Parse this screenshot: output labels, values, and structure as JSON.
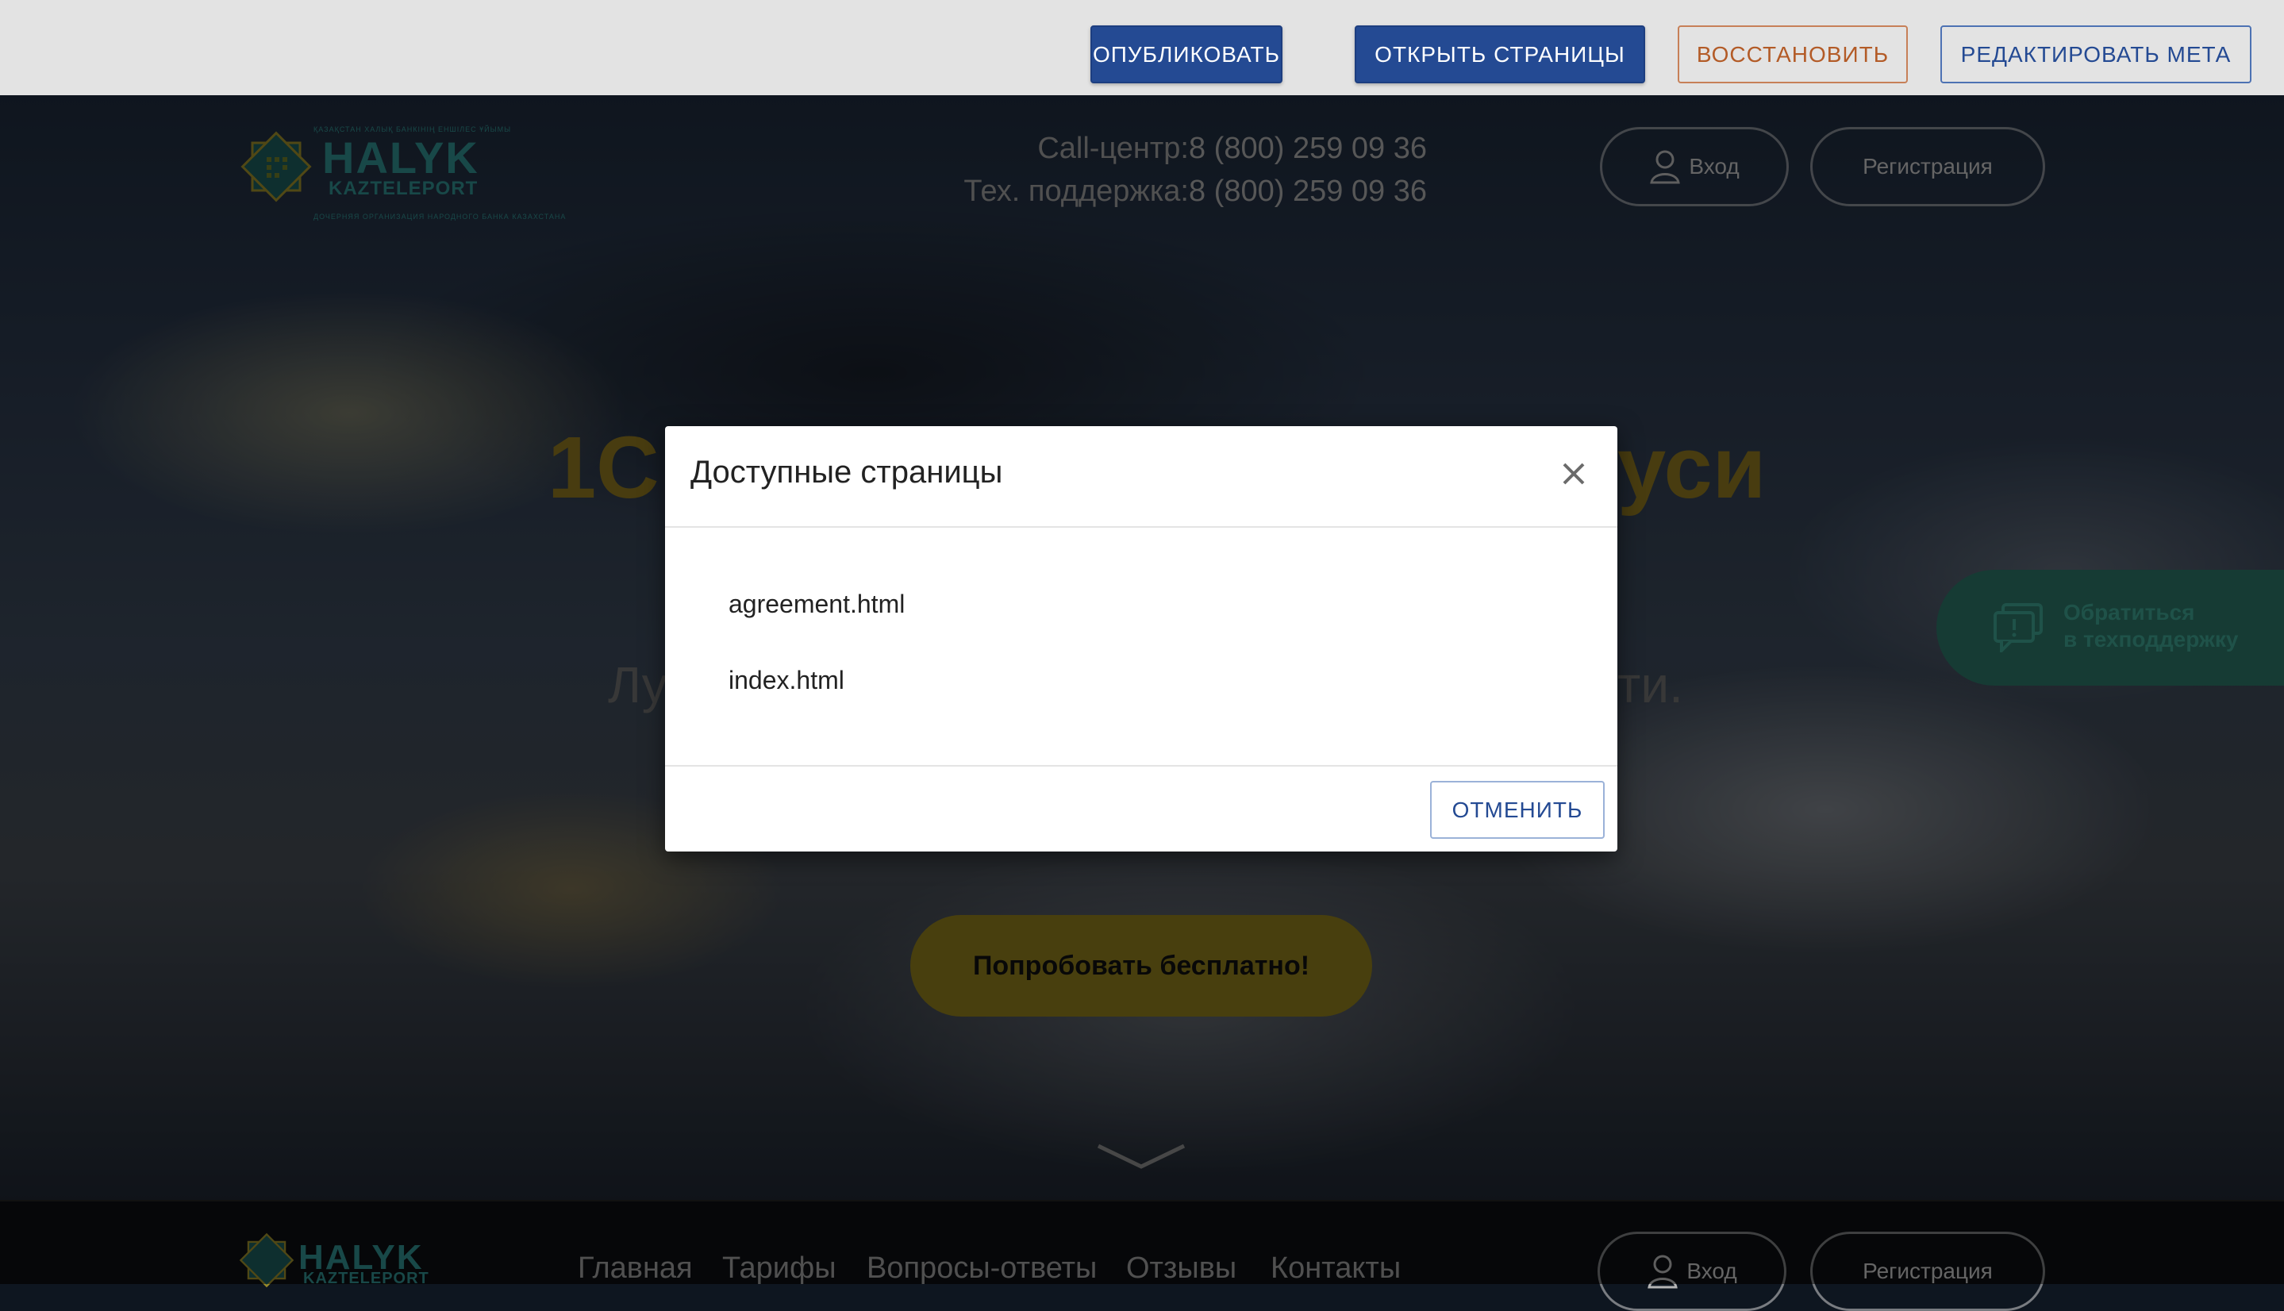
{
  "toolbar": {
    "publish_label": "Опубликовать",
    "open_pages_label": "Открыть страницы",
    "restore_label": "Восстановить",
    "edit_meta_label": "Редактировать мета"
  },
  "header": {
    "logo_text_main": "HALYK",
    "logo_text_sub": "KAZTELEPORT",
    "logo_tagline_top": "ҚАЗАҚСТАН ХАЛЫҚ БАНКІНІҢ ЕНШІЛЕС ҰЙЫМЫ",
    "logo_tagline_bottom": "ДОЧЕРНЯЯ ОРГАНИЗАЦИЯ НАРОДНОГО БАНКА КАЗАХСТАНА",
    "call_center_label": "Call-центр:",
    "call_center_phone": "8 (800) 259 09 36",
    "support_label": "Тех. поддержка:",
    "support_phone": "8 (800) 259 09 36",
    "login_label": "Вход",
    "register_label": "Регистрация"
  },
  "hero": {
    "title_left": "1С",
    "title_right": "уси",
    "subtitle_left": "Лу",
    "subtitle_right": "ти.",
    "cta_label": "Попробовать бесплатно!"
  },
  "support_widget": {
    "line1": "Обратиться",
    "line2": "в техподдержку"
  },
  "footer": {
    "nav": [
      "Главная",
      "Тарифы",
      "Вопросы-ответы",
      "Отзывы",
      "Контакты"
    ],
    "login_label": "Вход",
    "register_label": "Регистрация"
  },
  "modal": {
    "title": "Доступные страницы",
    "pages": [
      "agreement.html",
      "index.html"
    ],
    "cancel_label": "Отменить"
  },
  "colors": {
    "primary": "#244a93",
    "restore": "#b35b27",
    "brand_teal": "#2f8b8a",
    "gold": "#8a7a1c"
  }
}
